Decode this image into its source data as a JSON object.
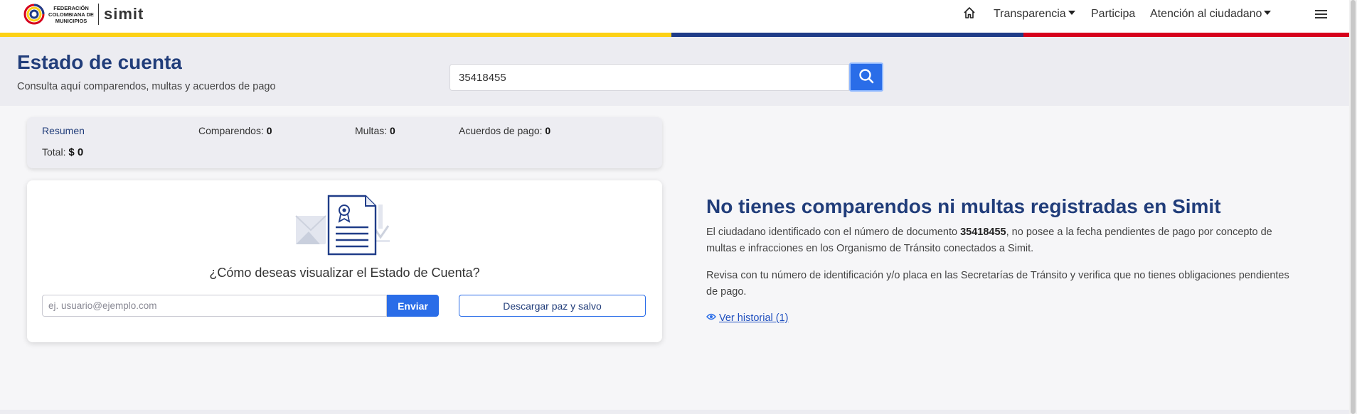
{
  "header": {
    "logo_org": "FEDERACIÓN COLOMBIANA DE MUNICIPIOS",
    "logo_brand": "simit",
    "nav": {
      "home_icon": "home-icon",
      "transparencia": "Transparencia",
      "participa": "Participa",
      "atencion": "Atención al ciudadano",
      "menu_icon": "hamburger-menu-icon"
    },
    "flag_colors": [
      "#fcd116",
      "#1f3c88",
      "#d6001c"
    ]
  },
  "page": {
    "title": "Estado de cuenta",
    "subtitle": "Consulta aquí comparendos, multas y acuerdos de pago"
  },
  "search": {
    "value": "35418455",
    "button_icon": "search-icon"
  },
  "summary": {
    "resumen_label": "Resumen",
    "comparendos_label": "Comparendos:",
    "comparendos_value": "0",
    "multas_label": "Multas:",
    "multas_value": "0",
    "acuerdos_label": "Acuerdos de pago:",
    "acuerdos_value": "0",
    "total_label": "Total:",
    "total_value": "$ 0"
  },
  "visualizar": {
    "question": "¿Cómo deseas visualizar el Estado de Cuenta?",
    "email_placeholder": "ej. usuario@ejemplo.com",
    "email_value": "",
    "send_label": "Enviar",
    "download_label": "Descargar paz y salvo",
    "illustration_icon": "certificate-document-icon"
  },
  "message": {
    "title": "No tienes comparendos ni multas registradas en Simit",
    "p1_before": "El ciudadano identificado con el número de documento ",
    "p1_doc": "35418455",
    "p1_after": ", no posee a la fecha pendientes de pago por concepto de multas e infracciones en los Organismo de Tránsito conectados a Simit.",
    "p2": "Revisa con tu número de identificación y/o placa en las Secretarías de Tránsito y verifica que no tienes obligaciones pendientes de pago.",
    "historial_icon": "eye-icon",
    "historial_label": "Ver historial (1)"
  },
  "colors": {
    "accent": "#2a6de8",
    "title": "#213d7a",
    "band": "#ececf1"
  }
}
